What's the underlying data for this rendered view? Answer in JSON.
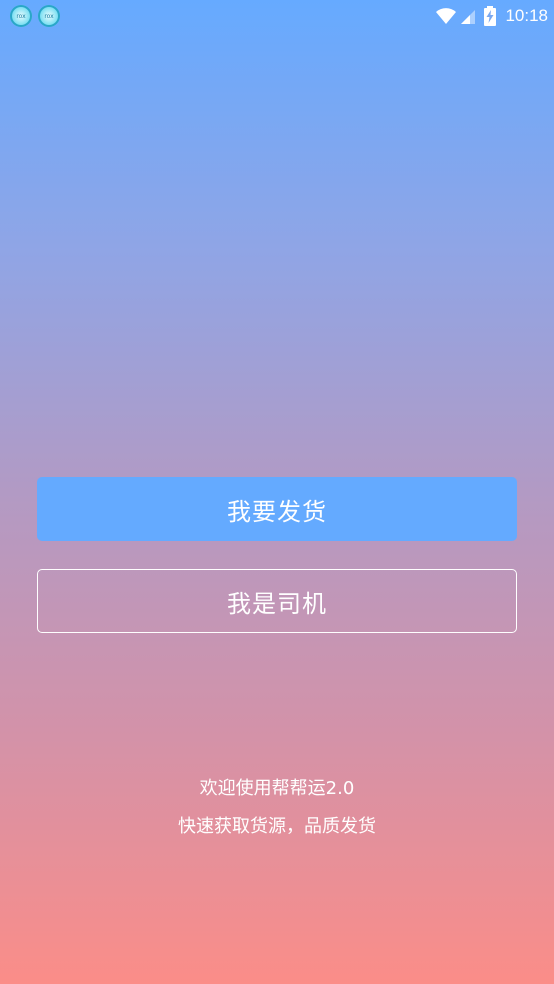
{
  "status_bar": {
    "notif_icon_1": "rox",
    "notif_icon_2": "rox",
    "time": "10:18"
  },
  "actions": {
    "ship_label": "我要发货",
    "driver_label": "我是司机"
  },
  "welcome": {
    "line1": "欢迎使用帮帮运2.0",
    "line2": "快速获取货源，品质发货"
  },
  "colors": {
    "gradient_top": "#66aaff",
    "gradient_bottom": "#fb8d88",
    "primary_button": "#64aaff"
  }
}
